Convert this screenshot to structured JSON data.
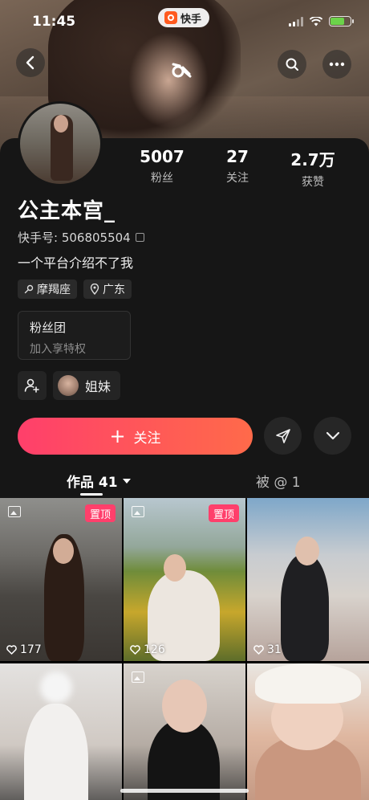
{
  "status_bar": {
    "time": "11:45",
    "app_name": "快手"
  },
  "profile": {
    "name": "公主本宫_",
    "id_label": "快手号: 506805504",
    "bio": "一个平台介绍不了我",
    "stats": [
      {
        "value": "5007",
        "label": "粉丝"
      },
      {
        "value": "27",
        "label": "关注"
      },
      {
        "value": "2.7万",
        "label": "获赞"
      }
    ],
    "tags": [
      {
        "icon": "constellation-icon",
        "label": "摩羯座"
      },
      {
        "icon": "location-icon",
        "label": "广东"
      }
    ],
    "fan_club": {
      "title": "粉丝团",
      "subtitle": "加入享特权"
    },
    "relation": {
      "label": "姐妹"
    }
  },
  "actions": {
    "follow_label": "关注"
  },
  "tabs": {
    "works": "作品 41",
    "tagged": "被 @ 1"
  },
  "grid": [
    {
      "pinned": "置顶",
      "likes": "177",
      "image_post": true
    },
    {
      "pinned": "置顶",
      "likes": "126",
      "image_post": true
    },
    {
      "likes": "31"
    },
    {
      "image_post": false
    },
    {
      "image_post": true
    },
    {
      "image_post": false
    }
  ],
  "colors": {
    "accent": "#ff4766",
    "card_bg": "#161616"
  }
}
